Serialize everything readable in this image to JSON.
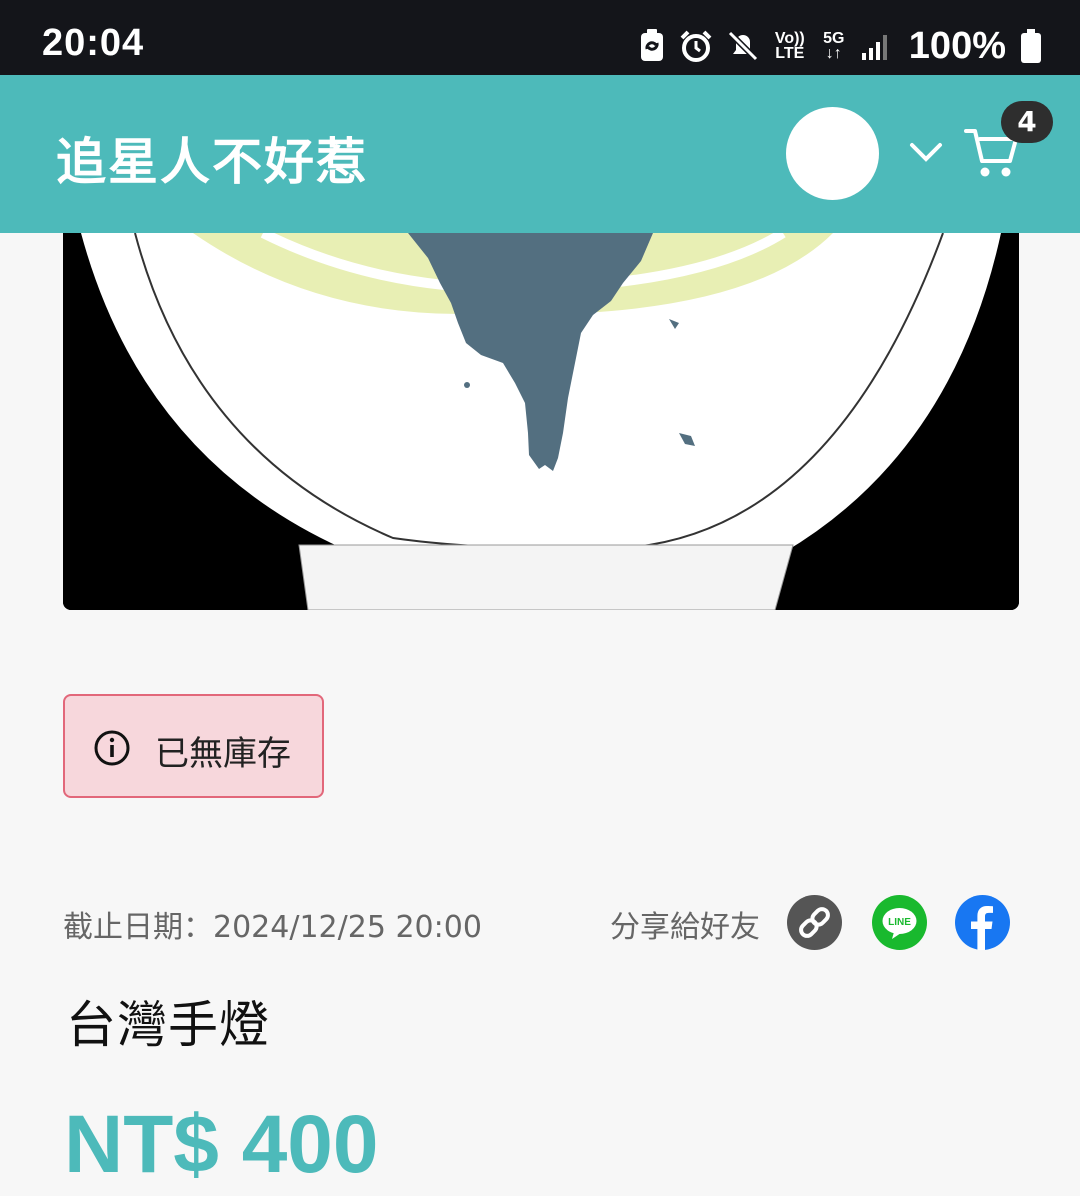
{
  "status_bar": {
    "time": "20:04",
    "battery": "100%",
    "network_volte": "Vo))",
    "network_lte": "LTE",
    "network_5g": "5G",
    "icons": [
      "sync-icon",
      "alarm-icon",
      "mute-icon",
      "volte-icon",
      "5g-icon",
      "signal-icon",
      "battery-icon"
    ]
  },
  "header": {
    "brand": "追星人不好惹",
    "cart_count": "4",
    "accent_color": "#4dbaba"
  },
  "product": {
    "stock_status": "已無庫存",
    "deadline": "截止日期：2024/12/25 20:00",
    "share_label": "分享給好友",
    "line_label": "LINE",
    "title": "台灣手燈",
    "price": "NT$ 400"
  },
  "colors": {
    "alert_bg": "#f7d7dc",
    "alert_border": "#e2677a",
    "line_green": "#19b92e",
    "facebook_blue": "#1877f2"
  }
}
